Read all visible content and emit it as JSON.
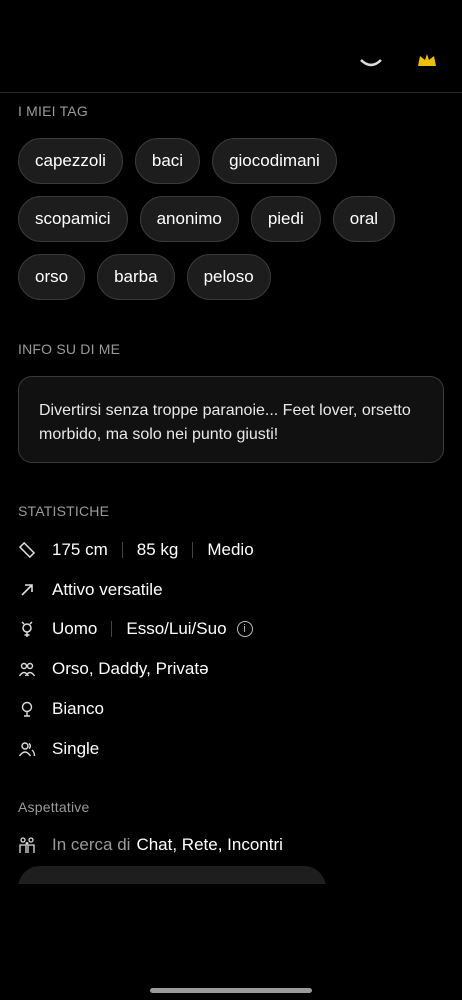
{
  "sections": {
    "tags_title": "I MIEI TAG",
    "about_title": "INFO SU DI ME",
    "stats_title": "STATISTICHE",
    "expect_title": "Aspettative"
  },
  "tags": [
    [
      "capezzoli",
      "baci",
      "giocodimani"
    ],
    [
      "scopamici",
      "anonimo",
      "piedi",
      "oral"
    ],
    [
      "orso",
      "barba",
      "peloso"
    ]
  ],
  "about": {
    "text": "Divertirsi senza troppe paranoie... Feet lover, orsetto morbido, ma solo nei punto giusti!"
  },
  "stats": {
    "height": "175 cm",
    "weight": "85 kg",
    "build": "Medio",
    "position": "Attivo versatile",
    "gender": "Uomo",
    "pronouns": "Esso/Lui/Suo",
    "tribes": "Orso, Daddy, Privatə",
    "ethnicity": "Bianco",
    "relationship": "Single"
  },
  "expectations": {
    "label": "In cerca di",
    "value": "Chat, Rete, Incontri"
  },
  "colors": {
    "background": "#000000",
    "chip": "#1d1d1d",
    "muted": "#9a9a9a",
    "accent": "#f0c000"
  },
  "icons": [
    "ruler-icon",
    "arrow-up-right-icon",
    "gender-icon",
    "info-icon",
    "people-icon",
    "globe-icon",
    "person-group-icon",
    "heart-people-icon"
  ]
}
